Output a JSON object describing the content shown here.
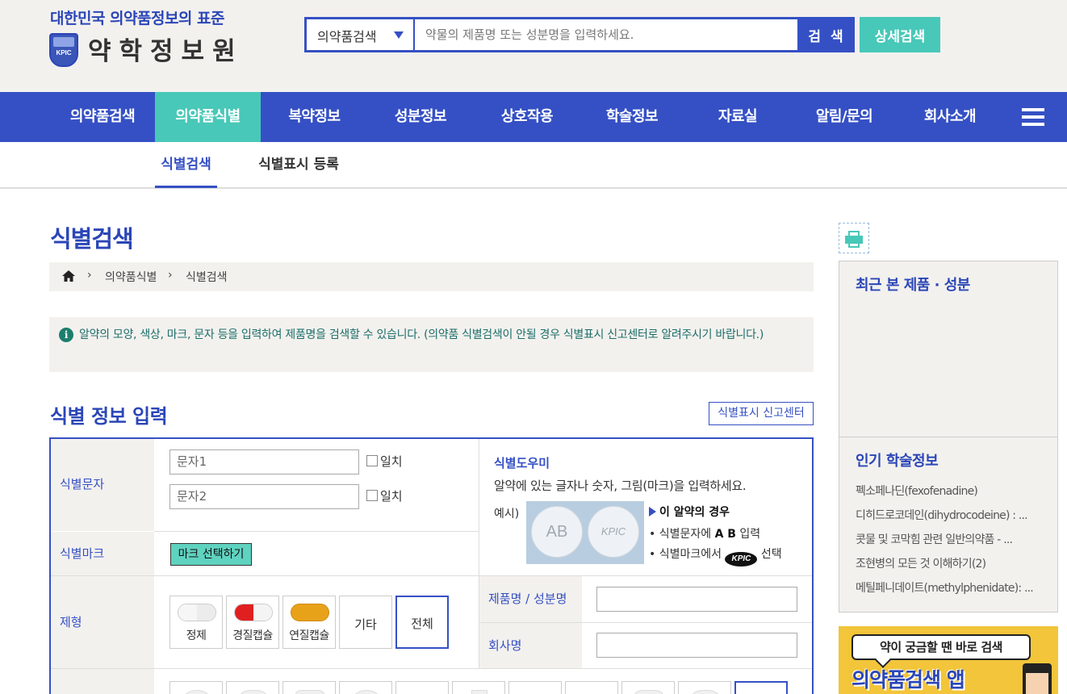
{
  "header": {
    "tagline": "대한민국 의약품정보의 표준",
    "logo_name": "약학정보원",
    "emblem_text": "KPIC",
    "search": {
      "category": "의약품검색",
      "placeholder": "약물의 제품명 또는 성분명을 입력하세요.",
      "button": "검 색",
      "detail_button": "상세검색"
    }
  },
  "nav": {
    "items": [
      "의약품검색",
      "의약품식별",
      "복약정보",
      "성분정보",
      "상호작용",
      "학술정보",
      "자료실",
      "알림/문의",
      "회사소개"
    ],
    "active": "의약품식별"
  },
  "subnav": {
    "items": [
      "식별검색",
      "식별표시 등록"
    ],
    "active": "식별검색"
  },
  "main": {
    "page_title": "식별검색",
    "breadcrumb": [
      "의약품식별",
      "식별검색"
    ],
    "notice": "알약의 모양, 색상, 마크, 문자 등을 입력하여 제품명을 검색할 수 있습니다. (의약품 식별검색이 안될 경우 식별표시 신고센터로 알려주시기 바랍니다.)",
    "section_title": "식별 정보 입력",
    "report_button": "식별표시 신고센터",
    "form": {
      "label_char": "식별문자",
      "char1_placeholder": "문자1",
      "char2_placeholder": "문자2",
      "exact_match": "일치",
      "label_mark": "식별마크",
      "mark_button": "마크 선택하기",
      "label_form": "제형",
      "forms": [
        "정제",
        "경질캡슐",
        "연질캡슐",
        "기타",
        "전체"
      ],
      "selected_form": "전체",
      "label_product": "제품명 / 성분명",
      "label_company": "회사명",
      "helper": {
        "title": "식별도우미",
        "desc": "알약에 있는 글자나 숫자, 그림(마크)을 입력하세요.",
        "example_label": "예시)",
        "pill1_text": "AB",
        "pill2_text": "KPIC",
        "case_title": "이 알약의 경우",
        "line1_prefix": "• 식별문자에",
        "line1_bold": "A B",
        "line1_suffix": "입력",
        "line2_prefix": "• 식별마크에서",
        "line2_mark": "KPIC",
        "line2_suffix": "선택"
      }
    }
  },
  "sidebar": {
    "recent_title": "최근 본 제품 · 성분",
    "popular_title": "인기 학술정보",
    "popular_items": [
      "펙소페나딘(fexofenadine)",
      "디히드로코데인(dihydrocodeine) : ...",
      "콧물 및 코막힘 관련 일반의약품 - ...",
      "조현병의 모든 것 이해하기(2)",
      "메틸페니데이트(methylphenidate): ..."
    ],
    "banner_bubble": "약이 궁금할 땐 바로 검색",
    "banner_app": "의약품검색 앱"
  },
  "colors": {
    "primary": "#3550c4",
    "accent": "#48c8b8",
    "panel": "#f3f1ee"
  },
  "icons": [
    "home-icon",
    "info-icon",
    "print-icon",
    "menu-icon",
    "caret-down-icon"
  ]
}
